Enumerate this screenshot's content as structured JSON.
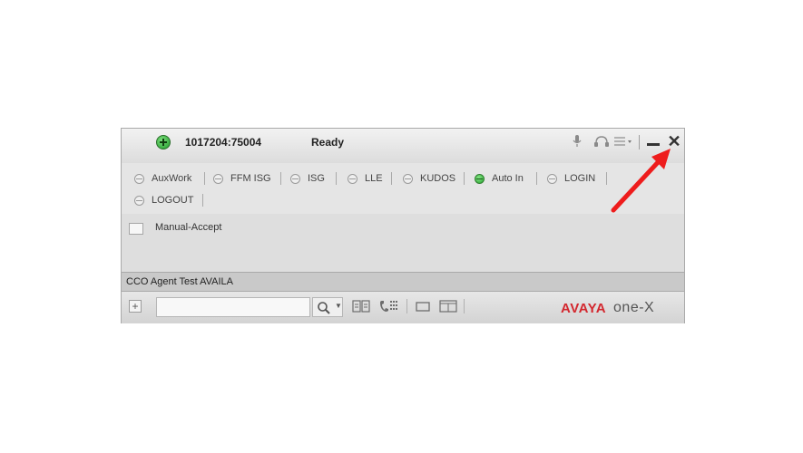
{
  "titlebar": {
    "extension": "1017204:75004",
    "state": "Ready"
  },
  "work_modes": [
    {
      "label": "AuxWork",
      "active": false
    },
    {
      "label": "FFM ISG",
      "active": false
    },
    {
      "label": "ISG",
      "active": false
    },
    {
      "label": "LLE",
      "active": false
    },
    {
      "label": "KUDOS",
      "active": false
    },
    {
      "label": "Auto In",
      "active": true
    },
    {
      "label": "LOGIN",
      "active": false
    },
    {
      "label": "LOGOUT",
      "active": false
    }
  ],
  "list": {
    "manual_accept_label": "Manual-Accept",
    "manual_accept_checked": false
  },
  "agent_status": "CCO Agent Test  AVAILA",
  "bottom": {
    "plus_label": "+",
    "search_value": "",
    "logo_brand": "AVAYA",
    "logo_product": "one-X"
  },
  "colors": {
    "brand_red": "#d3272e",
    "active_green": "#26a32f",
    "annotation_red": "#ee1c1c"
  },
  "icons": [
    "status-available-icon",
    "microphone-icon",
    "headset-icon",
    "menu-icon",
    "minimize-icon",
    "close-icon",
    "search-icon",
    "contacts-icon",
    "dialpad-icon",
    "window-icon",
    "calendar-icon"
  ]
}
